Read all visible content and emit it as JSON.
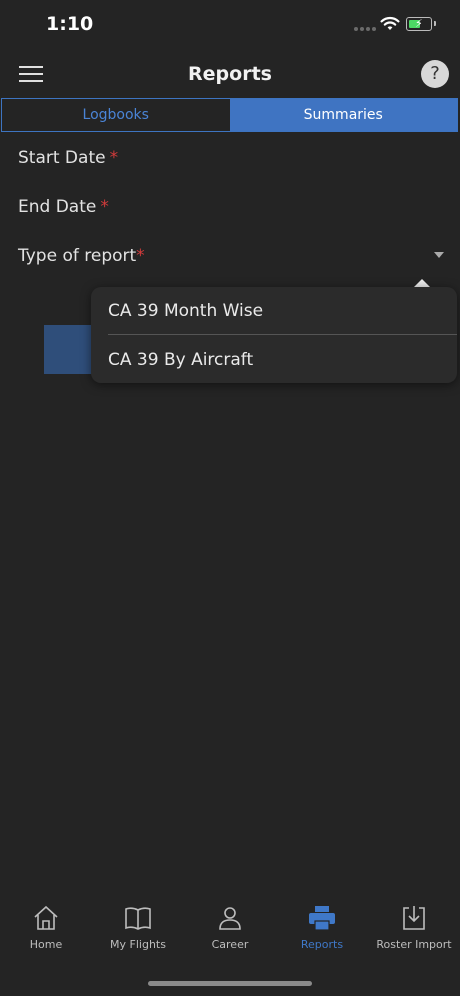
{
  "status_bar": {
    "time": "1:10"
  },
  "header": {
    "title": "Reports",
    "help_label": "?"
  },
  "tabs": [
    {
      "label": "Logbooks",
      "selected": false
    },
    {
      "label": "Summaries",
      "selected": true
    }
  ],
  "form": {
    "start_date_label": "Start Date",
    "end_date_label": "End Date",
    "type_label": "Type of report",
    "required_mark": "*"
  },
  "dropdown_options": [
    "CA 39 Month Wise",
    "CA 39 By Aircraft"
  ],
  "bottom_nav": [
    {
      "label": "Home",
      "icon": "home-icon",
      "active": false
    },
    {
      "label": "My Flights",
      "icon": "book-icon",
      "active": false
    },
    {
      "label": "Career",
      "icon": "person-icon",
      "active": false
    },
    {
      "label": "Reports",
      "icon": "printer-icon",
      "active": true
    },
    {
      "label": "Roster Import",
      "icon": "download-icon",
      "active": false
    }
  ],
  "colors": {
    "accent": "#3f74c2",
    "required": "#d23b3b",
    "background": "#242424"
  }
}
